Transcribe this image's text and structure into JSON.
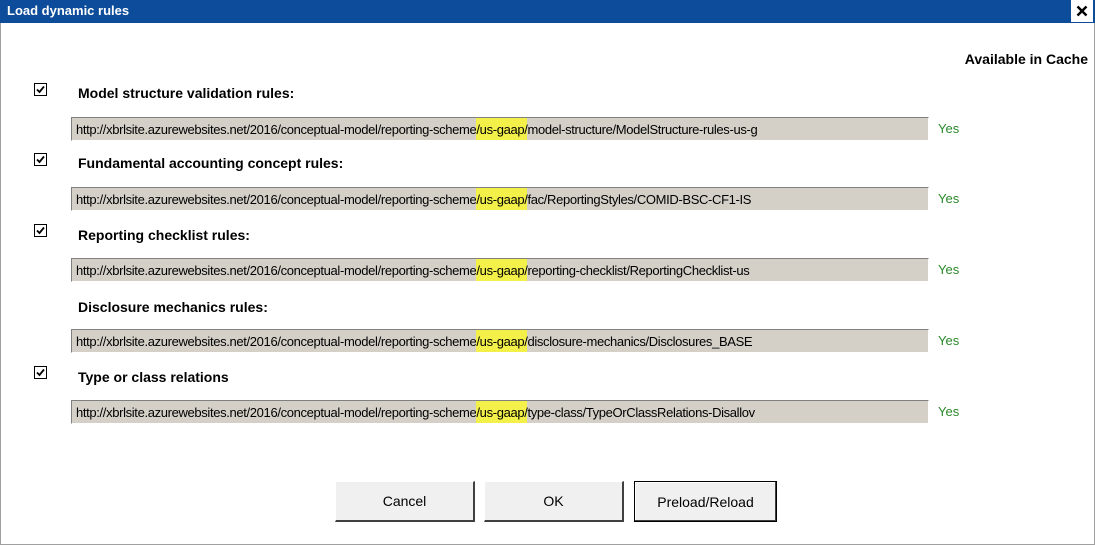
{
  "window": {
    "title": "Load dynamic rules"
  },
  "header": {
    "cache_label": "Available in Cache"
  },
  "rules": [
    {
      "label": "Model structure validation rules:",
      "checked": true,
      "url_prefix": "http://xbrlsite.azurewebsites.net/2016/conceptual-model/reporting-scheme",
      "url_highlight": "/us-gaap/",
      "url_suffix": "model-structure/ModelStructure-rules-us-g",
      "cache": "Yes"
    },
    {
      "label": "Fundamental accounting concept rules:",
      "checked": true,
      "url_prefix": "http://xbrlsite.azurewebsites.net/2016/conceptual-model/reporting-scheme",
      "url_highlight": "/us-gaap/",
      "url_suffix": "fac/ReportingStyles/COMID-BSC-CF1-IS",
      "cache": "Yes"
    },
    {
      "label": "Reporting checklist rules:",
      "checked": true,
      "url_prefix": "http://xbrlsite.azurewebsites.net/2016/conceptual-model/reporting-scheme",
      "url_highlight": "/us-gaap/",
      "url_suffix": "reporting-checklist/ReportingChecklist-us",
      "cache": "Yes"
    },
    {
      "label": "Disclosure mechanics rules:",
      "checked": false,
      "url_prefix": "http://xbrlsite.azurewebsites.net/2016/conceptual-model/reporting-scheme",
      "url_highlight": "/us-gaap/",
      "url_suffix": "disclosure-mechanics/Disclosures_BASE",
      "cache": "Yes"
    },
    {
      "label": "Type or class relations",
      "checked": true,
      "url_prefix": "http://xbrlsite.azurewebsites.net/2016/conceptual-model/reporting-scheme",
      "url_highlight": "/us-gaap/",
      "url_suffix": "type-class/TypeOrClassRelations-Disallov",
      "cache": "Yes"
    }
  ],
  "buttons": {
    "cancel": "Cancel",
    "ok": "OK",
    "preload": "Preload/Reload"
  },
  "colors": {
    "titlebar": "#0d4c9a",
    "highlight": "#f3f04a",
    "cache_yes": "#2a8a2a",
    "url_bg": "#d4d0c8"
  }
}
